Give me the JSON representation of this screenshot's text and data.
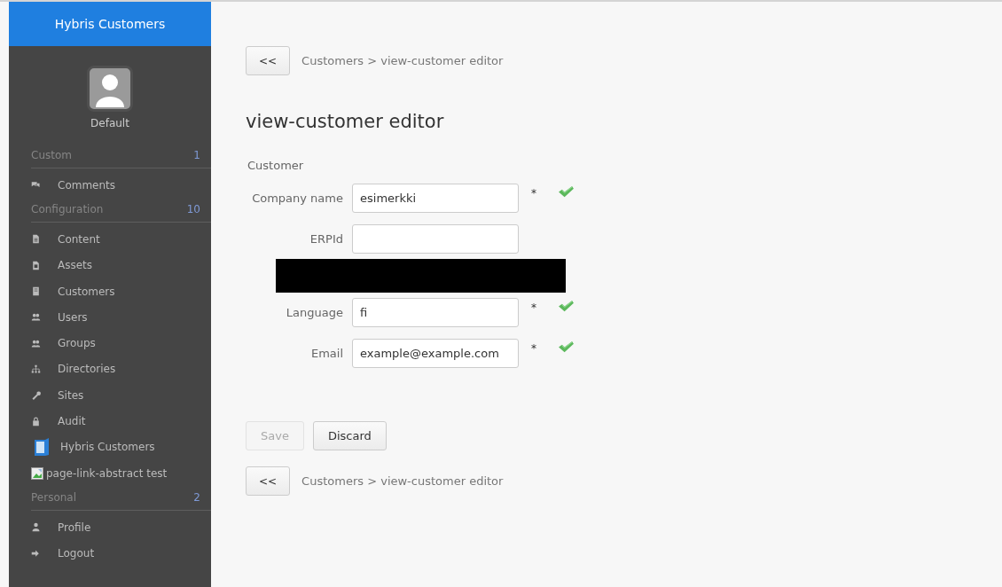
{
  "sidebar": {
    "title": "Hybris Customers",
    "user": "Default",
    "sections": [
      {
        "heading": "Custom",
        "count": "1",
        "items": [
          {
            "label": "Comments",
            "kind": "icon"
          }
        ]
      },
      {
        "heading": "Configuration",
        "count": "10",
        "items": [
          {
            "label": "Content",
            "kind": "icon"
          },
          {
            "label": "Assets",
            "kind": "icon"
          },
          {
            "label": "Customers",
            "kind": "icon"
          },
          {
            "label": "Users",
            "kind": "icon"
          },
          {
            "label": "Groups",
            "kind": "icon"
          },
          {
            "label": "Directories",
            "kind": "icon"
          },
          {
            "label": "Sites",
            "kind": "icon"
          },
          {
            "label": "Audit",
            "kind": "icon"
          },
          {
            "label": "Hybris Customers",
            "kind": "document-image"
          },
          {
            "label": "page-link-abstract test",
            "kind": "broken-image"
          }
        ]
      },
      {
        "heading": "Personal",
        "count": "2",
        "items": [
          {
            "label": "Profile",
            "kind": "icon"
          },
          {
            "label": "Logout",
            "kind": "icon"
          }
        ]
      }
    ]
  },
  "breadcrumb_top": {
    "back": "<<",
    "path": "Customers > view-customer editor"
  },
  "title": "view-customer editor",
  "section": "Customer",
  "fields": [
    {
      "kind": "field",
      "label": "Company name",
      "value": "esimerkki",
      "required_mark": "*",
      "valid": true
    },
    {
      "kind": "field",
      "label": "ERPId"
    },
    {
      "kind": "redacted"
    },
    {
      "kind": "field",
      "label": "Language",
      "value": "fi",
      "required_mark": "*",
      "valid": true
    },
    {
      "kind": "field",
      "label": "Email",
      "value": "example@example.com",
      "required_mark": "*",
      "valid": true
    }
  ],
  "buttons": [
    {
      "label": "Save",
      "disabled": true
    },
    {
      "label": "Discard",
      "disabled": false
    }
  ],
  "breadcrumb_bottom": {
    "back": "<<",
    "path": "Customers > view-customer editor"
  }
}
